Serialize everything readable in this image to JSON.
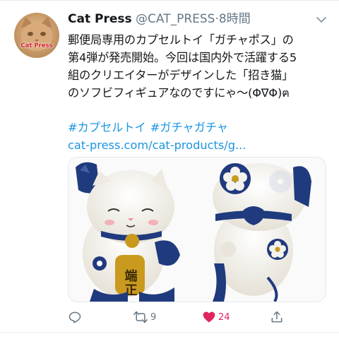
{
  "tweet": {
    "author_name": "Cat Press",
    "handle": "@CAT_PRESS",
    "separator": "·",
    "time": "8時間",
    "avatar_label": "Cat Press",
    "text_lines": [
      "郵便局専用のカプセルトイ「ガチャポス」の",
      "第4弾が発売開始。今回は国内外で活躍する5",
      "組のクリエイターがデザインした「招き猫」",
      "のソフビフィギュアなのですにゃ〜(Φ∇Φ)ฅ"
    ],
    "hashtags": [
      "#カプセルトイ",
      "#ガチャガチャ"
    ],
    "link": "cat-press.com/cat-products/g..."
  },
  "media": {
    "figure_left_plaque_text": "端正",
    "colors": {
      "body": "#f4f2ec",
      "indigo": "#203a7e",
      "gold": "#c99a1e",
      "cheek": "#f2b1b8"
    }
  },
  "actions": {
    "reply_icon": "reply-icon",
    "retweet_icon": "retweet-icon",
    "retweet_count": "9",
    "like_icon": "heart-icon",
    "like_count": "24",
    "like_color": "#e0245e",
    "share_icon": "share-icon"
  }
}
